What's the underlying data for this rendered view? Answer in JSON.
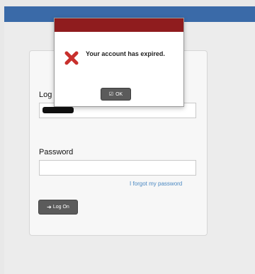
{
  "colors": {
    "topbar": "#3a6aa8",
    "dialog_header": "#8f1c1e",
    "error_icon": "#c8302d",
    "link": "#4a88c2",
    "button": "#5b5b5b"
  },
  "login": {
    "login_label": "Log",
    "password_label": "Password",
    "forgot_link": "I forgot my password",
    "logon_button": "Log On",
    "logon_icon": "sign-in-icon"
  },
  "dialog": {
    "message": "Your account has expired.",
    "icon": "error-x-icon",
    "ok_label": "OK",
    "ok_icon": "checkbox-icon"
  }
}
